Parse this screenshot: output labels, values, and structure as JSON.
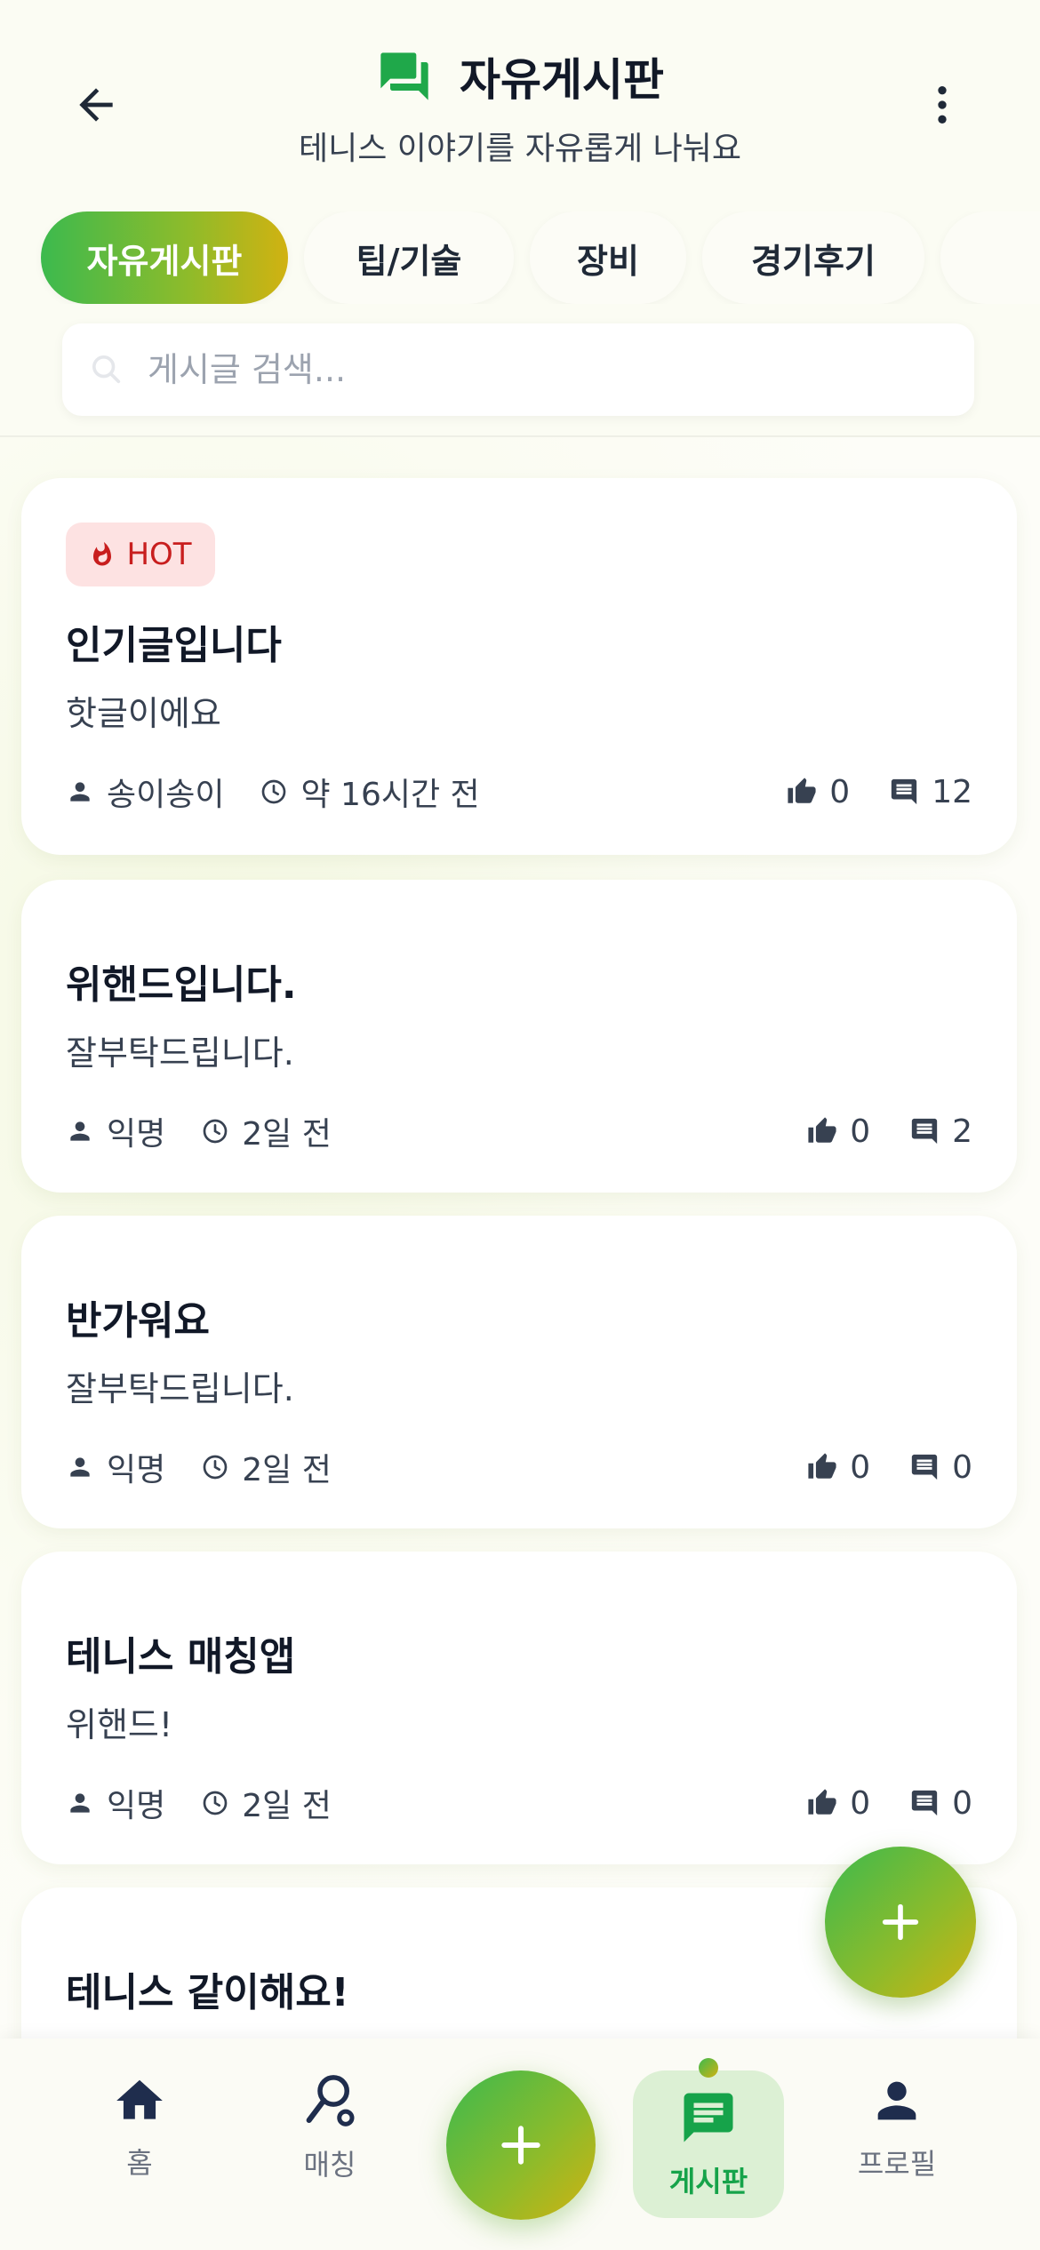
{
  "header": {
    "title": "자유게시판",
    "subtitle": "테니스 이야기를 자유롭게 나눠요"
  },
  "categories": [
    "자유게시판",
    "팁/기술",
    "장비",
    "경기후기"
  ],
  "search": {
    "placeholder": "게시글 검색..."
  },
  "posts": [
    {
      "badge": "HOT",
      "title": "인기글입니다",
      "body": "핫글이에요",
      "author": "송이송이",
      "time": "약 16시간 전",
      "likes": "0",
      "comments": "12"
    },
    {
      "title": "위핸드입니다.",
      "body": "잘부탁드립니다.",
      "author": "익명",
      "time": "2일 전",
      "likes": "0",
      "comments": "2"
    },
    {
      "title": "반가워요",
      "body": "잘부탁드립니다.",
      "author": "익명",
      "time": "2일 전",
      "likes": "0",
      "comments": "0"
    },
    {
      "title": "테니스 매칭앱",
      "body": "위핸드!",
      "author": "익명",
      "time": "2일 전",
      "likes": "0",
      "comments": "0"
    },
    {
      "title": "테니스 같이해요!"
    }
  ],
  "nav": {
    "home": "홈",
    "matching": "매칭",
    "board": "게시판",
    "profile": "프로필"
  },
  "colors": {
    "accent_green": "#3cba4e",
    "accent_yellow": "#d1b211",
    "hot_red": "#c81e1e",
    "nav_active_bg": "#dcf0d4"
  },
  "icons": [
    "arrow-left-icon",
    "chat-bubbles-icon",
    "more-vertical-icon",
    "search-icon",
    "fire-icon",
    "person-icon",
    "clock-icon",
    "thumb-up-icon",
    "comment-icon",
    "plus-icon",
    "home-icon",
    "racket-icon",
    "board-icon",
    "profile-icon"
  ]
}
